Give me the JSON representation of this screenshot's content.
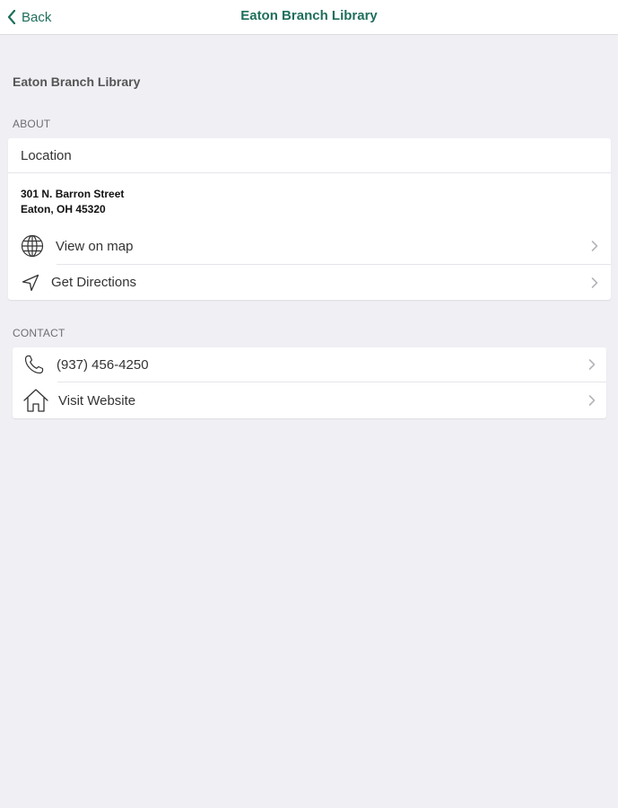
{
  "nav": {
    "back_label": "Back",
    "title": "Eaton Branch Library"
  },
  "page": {
    "heading": "Eaton Branch Library"
  },
  "about": {
    "section_label": "ABOUT",
    "location_label": "Location",
    "address_line1": "301 N. Barron Street",
    "address_line2": "Eaton, OH 45320",
    "view_map_label": "View on map",
    "directions_label": "Get Directions"
  },
  "contact": {
    "section_label": "CONTACT",
    "phone": "(937) 456-4250",
    "website_label": "Visit Website"
  },
  "colors": {
    "accent": "#1f6f5c",
    "background": "#efeff4"
  },
  "icons": [
    "chevron-left-icon",
    "globe-icon",
    "navigation-arrow-icon",
    "phone-icon",
    "home-icon",
    "chevron-right-icon"
  ]
}
